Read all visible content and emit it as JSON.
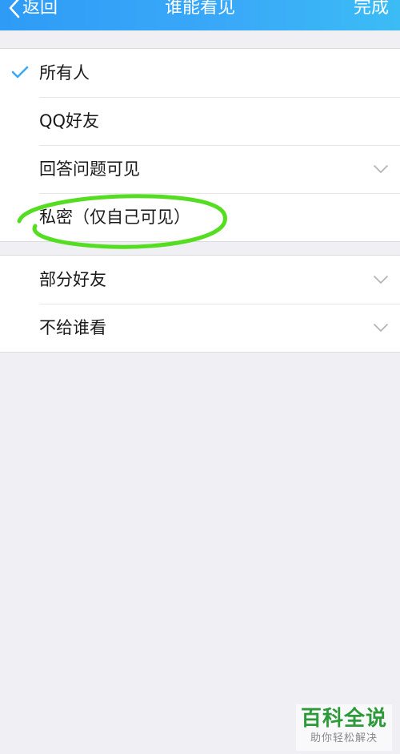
{
  "navbar": {
    "back_label": "返回",
    "title": "谁能看见",
    "done_label": "完成",
    "back_icon": "chevron-left-icon"
  },
  "options_group_1": [
    {
      "label": "所有人",
      "selected": true,
      "icon": "check-icon"
    },
    {
      "label": "QQ好友",
      "selected": false
    },
    {
      "label": "回答问题可见",
      "selected": false,
      "icon": "chevron-down-icon"
    },
    {
      "label": "私密（仅自己可见）",
      "selected": false
    }
  ],
  "options_group_2": [
    {
      "label": "部分好友",
      "icon": "chevron-down-icon"
    },
    {
      "label": "不给谁看",
      "icon": "chevron-down-icon"
    }
  ],
  "watermark": {
    "title": "百科全说",
    "subtitle": "助你轻松解决"
  },
  "colors": {
    "navbar": "#3aa8f8",
    "check": "#3aa8f8",
    "annotation": "#55dd22",
    "watermark": "#2c9a38",
    "background": "#efeff4"
  }
}
